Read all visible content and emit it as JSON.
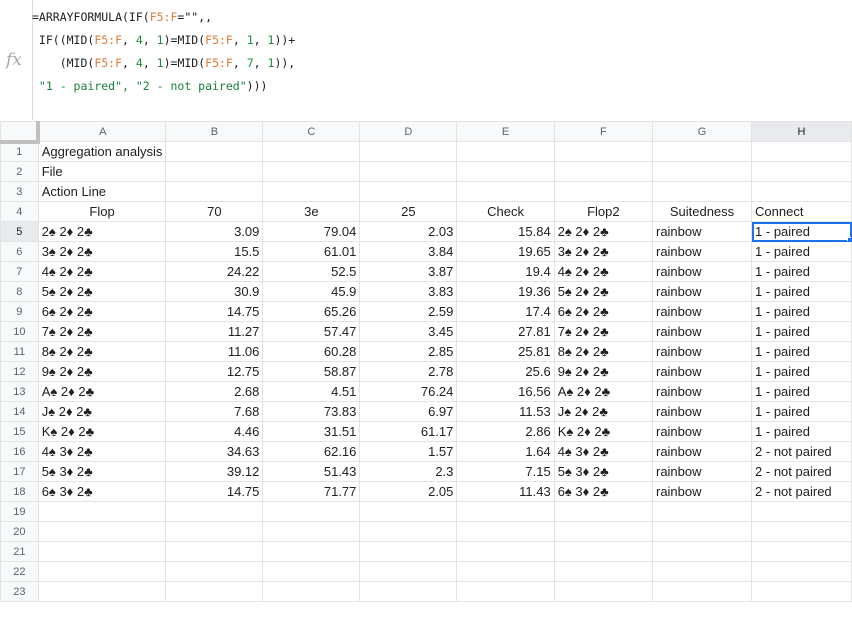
{
  "formula_bar": {
    "fx_icon": "fx-icon",
    "lines": [
      [
        {
          "t": "=ARRAYFORMULA(IF(",
          "c": "kw"
        },
        {
          "t": "F5:F",
          "c": "ref"
        },
        {
          "t": "=\"\",,",
          "c": "kw"
        }
      ],
      [
        {
          "t": " IF((MID(",
          "c": "kw"
        },
        {
          "t": "F5:F",
          "c": "ref"
        },
        {
          "t": ", ",
          "c": "kw"
        },
        {
          "t": "4",
          "c": "num"
        },
        {
          "t": ", ",
          "c": "kw"
        },
        {
          "t": "1",
          "c": "num"
        },
        {
          "t": ")=MID(",
          "c": "kw"
        },
        {
          "t": "F5:F",
          "c": "ref"
        },
        {
          "t": ", ",
          "c": "kw"
        },
        {
          "t": "1",
          "c": "num"
        },
        {
          "t": ", ",
          "c": "kw"
        },
        {
          "t": "1",
          "c": "num"
        },
        {
          "t": "))+",
          "c": "kw"
        }
      ],
      [
        {
          "t": "    (MID(",
          "c": "kw"
        },
        {
          "t": "F5:F",
          "c": "ref"
        },
        {
          "t": ", ",
          "c": "kw"
        },
        {
          "t": "4",
          "c": "num"
        },
        {
          "t": ", ",
          "c": "kw"
        },
        {
          "t": "1",
          "c": "num"
        },
        {
          "t": ")=MID(",
          "c": "kw"
        },
        {
          "t": "F5:F",
          "c": "ref"
        },
        {
          "t": ", ",
          "c": "kw"
        },
        {
          "t": "7",
          "c": "num"
        },
        {
          "t": ", ",
          "c": "kw"
        },
        {
          "t": "1",
          "c": "num"
        },
        {
          "t": ")),",
          "c": "kw"
        }
      ],
      [
        {
          "t": " \"1 - paired\", \"2 - not paired\"",
          "c": "str"
        },
        {
          "t": ")))",
          "c": "kw"
        }
      ]
    ]
  },
  "columns": [
    "A",
    "B",
    "C",
    "D",
    "E",
    "F",
    "G",
    "H"
  ],
  "selected_column": "H",
  "selected_row": 5,
  "rows": [
    {
      "n": "1",
      "cells": [
        "Aggregation analysis",
        "",
        "",
        "",
        "",
        "",
        "",
        ""
      ]
    },
    {
      "n": "2",
      "cells": [
        "File",
        "",
        "",
        "",
        "",
        "",
        "",
        ""
      ]
    },
    {
      "n": "3",
      "cells": [
        "Action Line",
        "",
        "",
        "",
        "",
        "",
        "",
        ""
      ]
    },
    {
      "n": "4",
      "cells": [
        "Flop",
        "70",
        "3e",
        "25",
        "Check",
        "Flop2",
        "Suitedness",
        "Connect"
      ]
    },
    {
      "n": "5",
      "cells": [
        "2♠ 2♦ 2♣",
        "3.09",
        "79.04",
        "2.03",
        "15.84",
        "2♠ 2♦ 2♣",
        "rainbow",
        "1 - paired"
      ]
    },
    {
      "n": "6",
      "cells": [
        "3♠ 2♦ 2♣",
        "15.5",
        "61.01",
        "3.84",
        "19.65",
        "3♠ 2♦ 2♣",
        "rainbow",
        "1 - paired"
      ]
    },
    {
      "n": "7",
      "cells": [
        "4♠ 2♦ 2♣",
        "24.22",
        "52.5",
        "3.87",
        "19.4",
        "4♠ 2♦ 2♣",
        "rainbow",
        "1 - paired"
      ]
    },
    {
      "n": "8",
      "cells": [
        "5♠ 2♦ 2♣",
        "30.9",
        "45.9",
        "3.83",
        "19.36",
        "5♠ 2♦ 2♣",
        "rainbow",
        "1 - paired"
      ]
    },
    {
      "n": "9",
      "cells": [
        "6♠ 2♦ 2♣",
        "14.75",
        "65.26",
        "2.59",
        "17.4",
        "6♠ 2♦ 2♣",
        "rainbow",
        "1 - paired"
      ]
    },
    {
      "n": "10",
      "cells": [
        "7♠ 2♦ 2♣",
        "11.27",
        "57.47",
        "3.45",
        "27.81",
        "7♠ 2♦ 2♣",
        "rainbow",
        "1 - paired"
      ]
    },
    {
      "n": "11",
      "cells": [
        "8♠ 2♦ 2♣",
        "11.06",
        "60.28",
        "2.85",
        "25.81",
        "8♠ 2♦ 2♣",
        "rainbow",
        "1 - paired"
      ]
    },
    {
      "n": "12",
      "cells": [
        "9♠ 2♦ 2♣",
        "12.75",
        "58.87",
        "2.78",
        "25.6",
        "9♠ 2♦ 2♣",
        "rainbow",
        "1 - paired"
      ]
    },
    {
      "n": "13",
      "cells": [
        "A♠ 2♦ 2♣",
        "2.68",
        "4.51",
        "76.24",
        "16.56",
        "A♠ 2♦ 2♣",
        "rainbow",
        "1 - paired"
      ]
    },
    {
      "n": "14",
      "cells": [
        "J♠ 2♦ 2♣",
        "7.68",
        "73.83",
        "6.97",
        "11.53",
        "J♠ 2♦ 2♣",
        "rainbow",
        "1 - paired"
      ]
    },
    {
      "n": "15",
      "cells": [
        "K♠ 2♦ 2♣",
        "4.46",
        "31.51",
        "61.17",
        "2.86",
        "K♠ 2♦ 2♣",
        "rainbow",
        "1 - paired"
      ]
    },
    {
      "n": "16",
      "cells": [
        "4♠ 3♦ 2♣",
        "34.63",
        "62.16",
        "1.57",
        "1.64",
        "4♠ 3♦ 2♣",
        "rainbow",
        "2 - not paired"
      ]
    },
    {
      "n": "17",
      "cells": [
        "5♠ 3♦ 2♣",
        "39.12",
        "51.43",
        "2.3",
        "7.15",
        "5♠ 3♦ 2♣",
        "rainbow",
        "2 - not paired"
      ]
    },
    {
      "n": "18",
      "cells": [
        "6♠ 3♦ 2♣",
        "14.75",
        "71.77",
        "2.05",
        "11.43",
        "6♠ 3♦ 2♣",
        "rainbow",
        "2 - not paired"
      ]
    },
    {
      "n": "19",
      "cells": [
        "",
        "",
        "",
        "",
        "",
        "",
        "",
        ""
      ]
    },
    {
      "n": "20",
      "cells": [
        "",
        "",
        "",
        "",
        "",
        "",
        "",
        ""
      ]
    },
    {
      "n": "21",
      "cells": [
        "",
        "",
        "",
        "",
        "",
        "",
        "",
        ""
      ]
    },
    {
      "n": "22",
      "cells": [
        "",
        "",
        "",
        "",
        "",
        "",
        "",
        ""
      ]
    },
    {
      "n": "23",
      "cells": [
        "",
        "",
        "",
        "",
        "",
        "",
        "",
        ""
      ]
    }
  ]
}
